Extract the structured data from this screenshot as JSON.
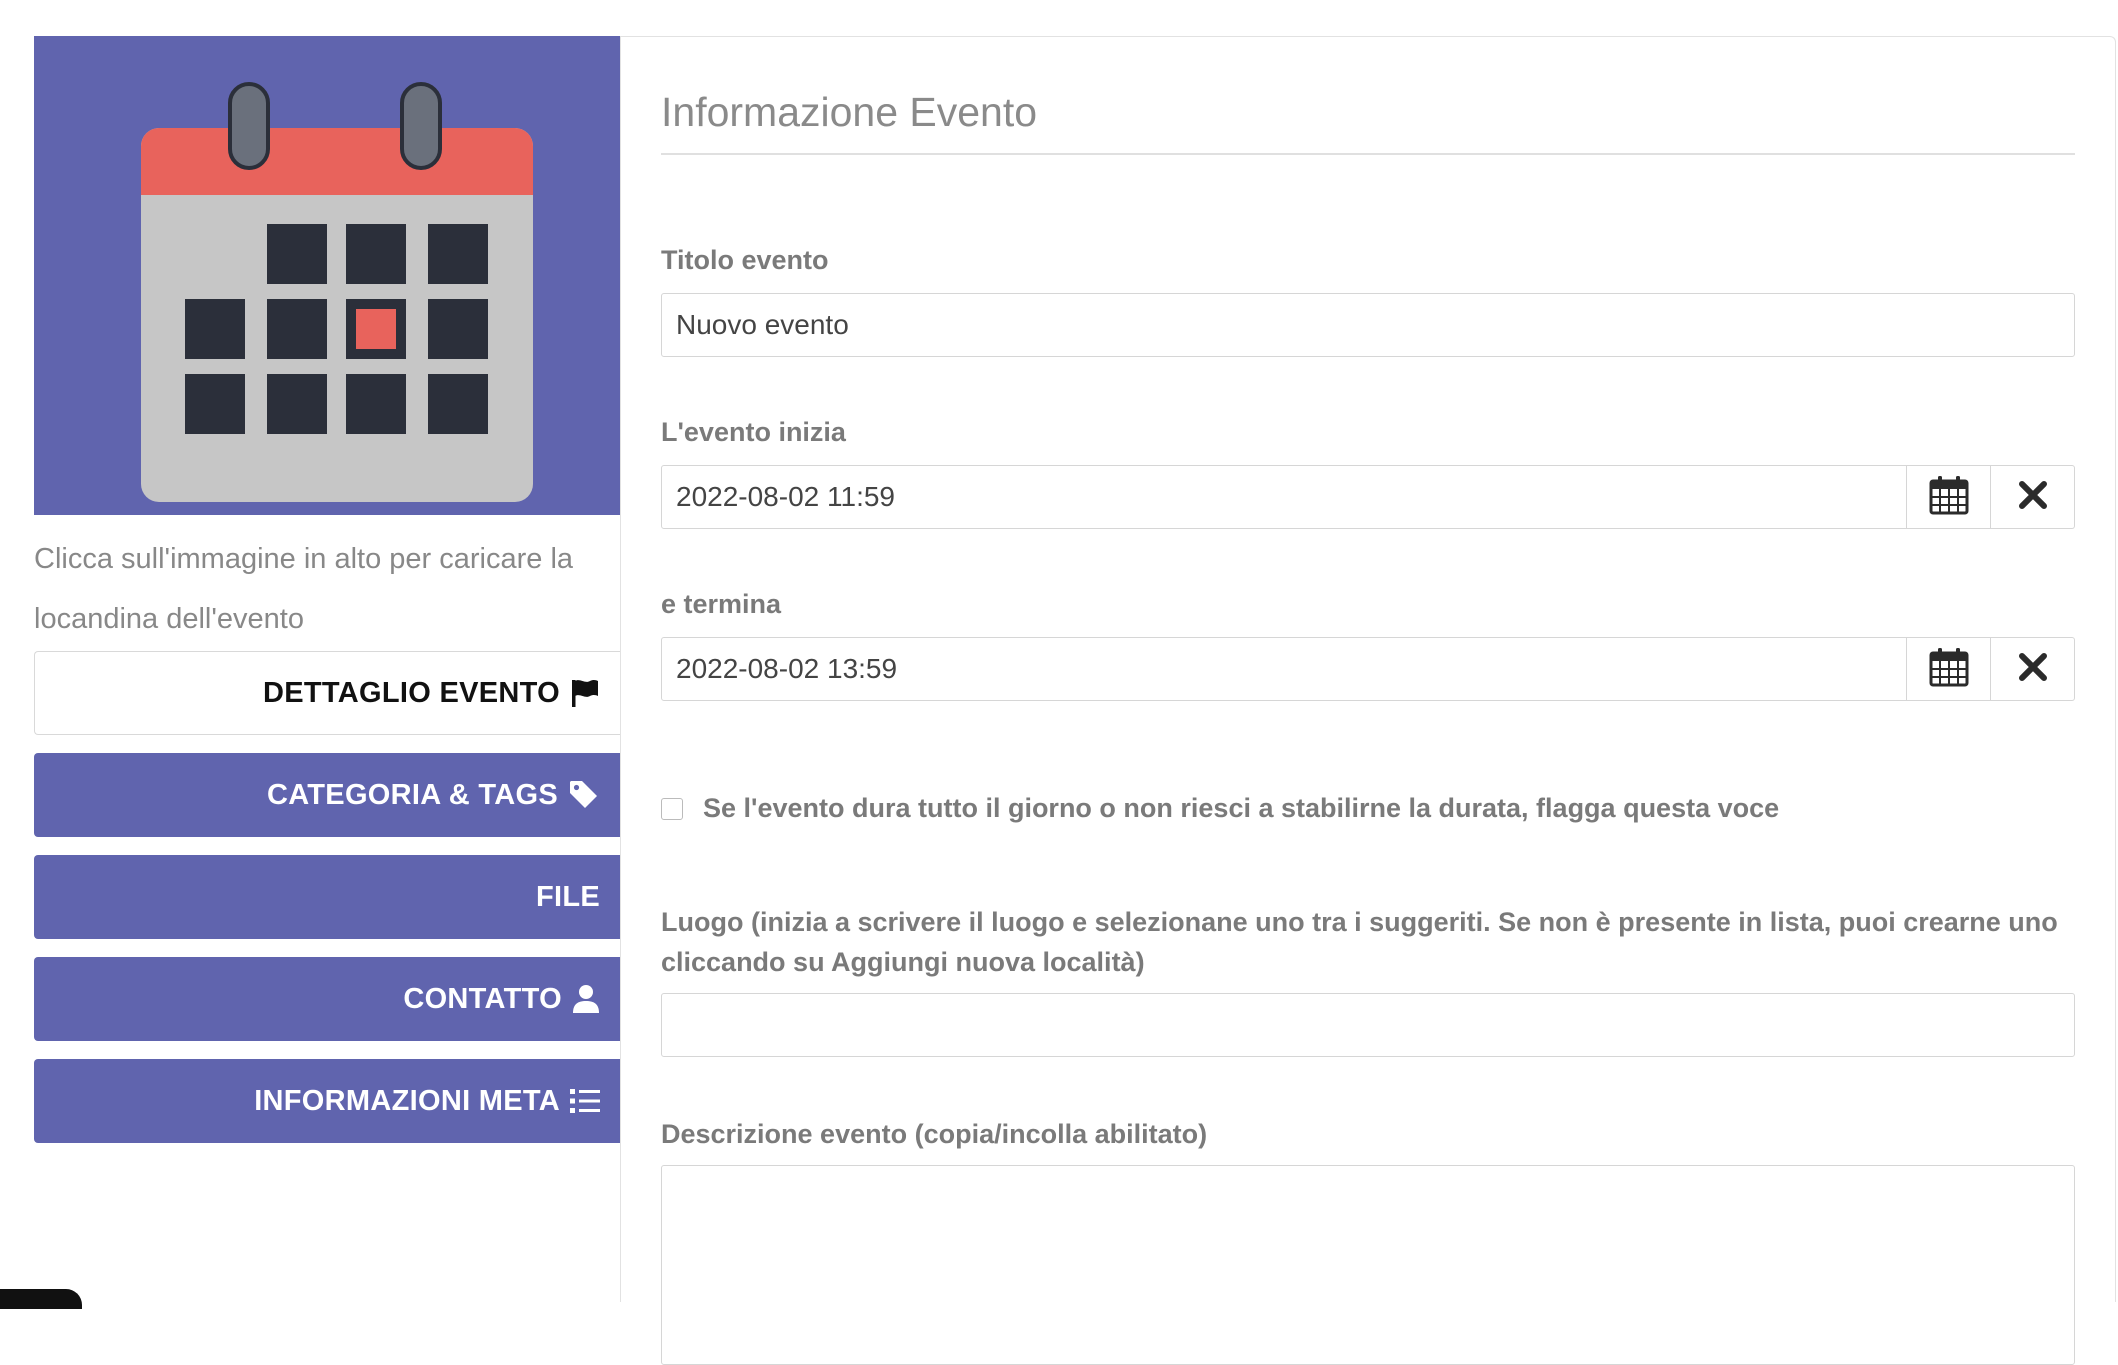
{
  "sidebar": {
    "poster_hint": "Clicca sull'immagine in alto per caricare la locandina dell'evento",
    "nav": [
      {
        "label": "DETTAGLIO EVENTO",
        "icon": "flag-icon",
        "active": true
      },
      {
        "label": "CATEGORIA & TAGS",
        "icon": "tag-icon",
        "active": false
      },
      {
        "label": "FILE",
        "icon": "",
        "active": false
      },
      {
        "label": "CONTATTO",
        "icon": "user-icon",
        "active": false
      },
      {
        "label": "INFORMAZIONI META",
        "icon": "list-icon",
        "active": false
      }
    ]
  },
  "form": {
    "title": "Informazione Evento",
    "event_title_label": "Titolo evento",
    "event_title_value": "Nuovo evento",
    "start_label": "L'evento inizia",
    "start_value": "2022-08-02 11:59",
    "end_label": "e termina",
    "end_value": "2022-08-02 13:59",
    "allday_label": "Se l'evento dura tutto il giorno o non riesci a stabilirne la durata, flagga questa voce",
    "location_label": "Luogo (inizia a scrivere il luogo e selezionane uno tra i suggeriti. Se non è presente in lista, puoi crearne uno cliccando su Aggiungi nuova località)",
    "location_value": "",
    "description_label": "Descrizione evento (copia/incolla abilitato)"
  },
  "colors": {
    "primary": "#6064ae",
    "calendar_red": "#e8635c",
    "calendar_dark": "#2b2f3a"
  }
}
